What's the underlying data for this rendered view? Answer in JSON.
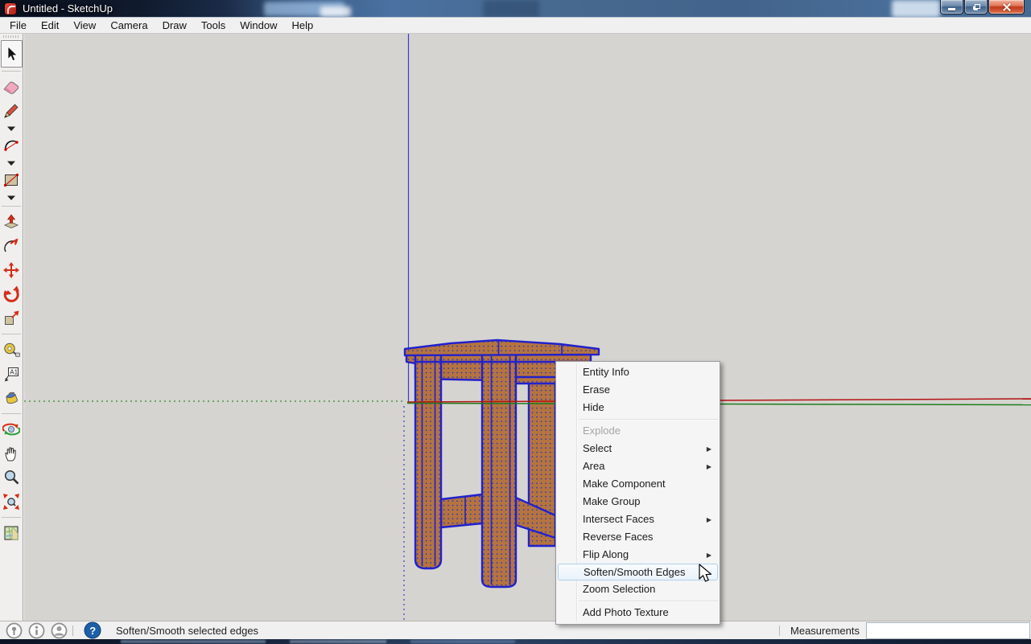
{
  "window": {
    "title": "Untitled - SketchUp",
    "controls": [
      {
        "name": "minimize-button",
        "icon": "minimize-icon"
      },
      {
        "name": "restore-button",
        "icon": "restore-icon"
      },
      {
        "name": "close-button",
        "icon": "close-icon"
      }
    ]
  },
  "menu_bar": {
    "items": [
      "File",
      "Edit",
      "View",
      "Camera",
      "Draw",
      "Tools",
      "Window",
      "Help"
    ]
  },
  "toolbar": {
    "items": [
      {
        "type": "tool",
        "name": "select",
        "icon": "select-icon",
        "active": true
      },
      {
        "type": "separator"
      },
      {
        "type": "tool",
        "name": "eraser",
        "icon": "eraser-icon"
      },
      {
        "type": "tool",
        "name": "line",
        "icon": "pencil-icon"
      },
      {
        "type": "dropdown",
        "name": "line-tools"
      },
      {
        "type": "tool",
        "name": "arc",
        "icon": "arc-icon"
      },
      {
        "type": "dropdown",
        "name": "arc-tools"
      },
      {
        "type": "tool",
        "name": "rectangle",
        "icon": "rectangle-icon"
      },
      {
        "type": "dropdown",
        "name": "shape-tools"
      },
      {
        "type": "separator"
      },
      {
        "type": "tool",
        "name": "push-pull",
        "icon": "push-pull-icon"
      },
      {
        "type": "tool",
        "name": "follow-me",
        "icon": "follow-me-icon"
      },
      {
        "type": "tool",
        "name": "move",
        "icon": "move-icon"
      },
      {
        "type": "tool",
        "name": "rotate",
        "icon": "rotate-icon"
      },
      {
        "type": "tool",
        "name": "scale",
        "icon": "scale-icon"
      },
      {
        "type": "separator"
      },
      {
        "type": "tool",
        "name": "tape-measure",
        "icon": "tape-measure-icon"
      },
      {
        "type": "tool",
        "name": "dimension-text",
        "icon": "text-icon"
      },
      {
        "type": "tool",
        "name": "paint-bucket",
        "icon": "paint-bucket-icon"
      },
      {
        "type": "separator"
      },
      {
        "type": "tool",
        "name": "orbit",
        "icon": "orbit-icon"
      },
      {
        "type": "tool",
        "name": "pan",
        "icon": "pan-icon"
      },
      {
        "type": "tool",
        "name": "zoom",
        "icon": "zoom-icon"
      },
      {
        "type": "tool",
        "name": "zoom-extents",
        "icon": "zoom-extents-icon"
      },
      {
        "type": "separator"
      },
      {
        "type": "tool",
        "name": "add-location",
        "icon": "add-location-icon"
      }
    ]
  },
  "context_menu": {
    "items": [
      {
        "label": "Entity Info"
      },
      {
        "label": "Erase"
      },
      {
        "label": "Hide"
      },
      {
        "separator": true
      },
      {
        "label": "Explode",
        "state": "disabled"
      },
      {
        "label": "Select",
        "submenu": true
      },
      {
        "label": "Area",
        "submenu": true
      },
      {
        "label": "Make Component"
      },
      {
        "label": "Make Group"
      },
      {
        "label": "Intersect Faces",
        "submenu": true
      },
      {
        "label": "Reverse Faces"
      },
      {
        "label": "Flip Along",
        "submenu": true
      },
      {
        "label": "Soften/Smooth Edges",
        "state": "highlighted"
      },
      {
        "label": "Zoom Selection"
      },
      {
        "separator": true
      },
      {
        "label": "Add Photo Texture"
      }
    ]
  },
  "status_bar": {
    "icons": [
      "geolocation-icon",
      "model-info-icon",
      "credits-icon",
      "help-icon"
    ],
    "message": "Soften/Smooth selected edges",
    "measurements_label": "Measurements",
    "measurements_value": ""
  },
  "colors": {
    "canvas_bg": "#d5d4d0",
    "face_orange": "#b5743f",
    "edge_blue": "#2121cd",
    "axis_red": "#b51212",
    "axis_green": "#1e7d1e",
    "axis_blue": "#3b3bd0",
    "menu_highlight_bg": "#eaf3fb",
    "menu_highlight_border": "#b0d0ec",
    "help_blue": "#1d5fa8",
    "close_red": "#c03a1c"
  }
}
